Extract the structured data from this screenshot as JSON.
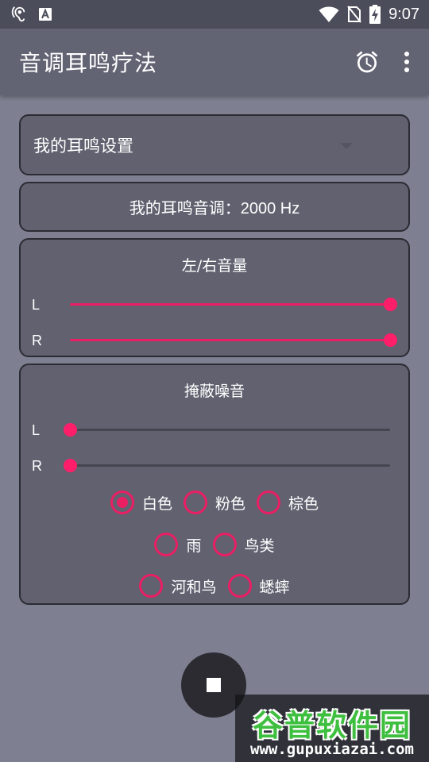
{
  "status_bar": {
    "time": "9:07",
    "icons_left": [
      "hearing-icon",
      "a-accessibility-icon"
    ],
    "icons_right": [
      "wifi-icon",
      "no-sim-icon",
      "battery-charging-icon"
    ]
  },
  "app_bar": {
    "title": "音调耳鸣疗法",
    "actions": [
      "alarm-icon",
      "more-vert-icon"
    ]
  },
  "profile_dropdown": {
    "selected": "我的耳鸣设置"
  },
  "pitch": {
    "label": "我的耳鸣音调：2000 Hz"
  },
  "volume": {
    "title": "左/右音量",
    "left_label": "L",
    "right_label": "R",
    "left_value": 1.0,
    "right_value": 1.0
  },
  "masking": {
    "title": "掩蔽噪音",
    "left_label": "L",
    "right_label": "R",
    "left_value": 0.0,
    "right_value": 0.0,
    "options": [
      {
        "label": "白色",
        "checked": true
      },
      {
        "label": "粉色",
        "checked": false
      },
      {
        "label": "棕色",
        "checked": false
      },
      {
        "label": "雨",
        "checked": false
      },
      {
        "label": "鸟类",
        "checked": false
      },
      {
        "label": "河和鸟",
        "checked": false
      },
      {
        "label": "蟋蟀",
        "checked": false
      }
    ]
  },
  "stop_button": {
    "icon": "stop-icon"
  },
  "watermark": {
    "brand": "谷普软件园",
    "url": "www.gupuxiazai.com"
  },
  "colors": {
    "background": "#7e7f91",
    "app_bar": "#626373",
    "card": "#616170",
    "accent": "#e91e63",
    "fab": "#2b2b31"
  }
}
